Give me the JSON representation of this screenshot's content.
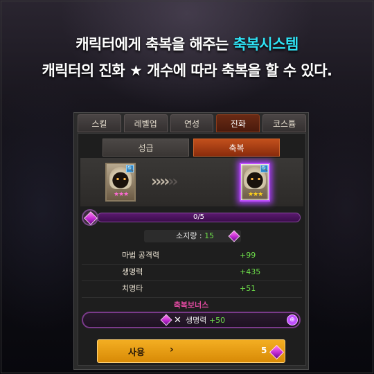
{
  "headline": {
    "line1_prefix": "캐릭터에게 축복을 해주는 ",
    "line1_accent": "축복시스템",
    "line2": "캐릭터의 진화 ★ 개수에 따라 축복을 할 수 있다."
  },
  "tabs": [
    {
      "label": "스킬"
    },
    {
      "label": "레벨업"
    },
    {
      "label": "연성"
    },
    {
      "label": "진화",
      "active": true
    },
    {
      "label": "코스튬"
    }
  ],
  "subtabs": [
    {
      "label": "성급"
    },
    {
      "label": "축복",
      "active": true
    }
  ],
  "portraits": {
    "before_stars": "★★★",
    "after_stars": "★★★",
    "magnify_icon": "🔍"
  },
  "progress": {
    "label": "0/5",
    "fraction": 0
  },
  "holding": {
    "label": "소지량 : ",
    "value": "15"
  },
  "stats": [
    {
      "name": "마법 공격력",
      "value": "+99"
    },
    {
      "name": "생명력",
      "value": "+435"
    },
    {
      "name": "치명타",
      "value": "+51"
    }
  ],
  "bonus": {
    "title": "축복보너스",
    "multiplier": "✕",
    "stat_name": "생명력 ",
    "stat_value": "+50"
  },
  "use_button": {
    "label": "사용",
    "chevron": "›",
    "cost": "5"
  },
  "colors": {
    "accent": "#2fe3f5",
    "active_tab": "#8a3a1a",
    "gem_purple": "#c02ad0",
    "positive": "#6ee04a",
    "button_gold": "#f3ae22"
  }
}
